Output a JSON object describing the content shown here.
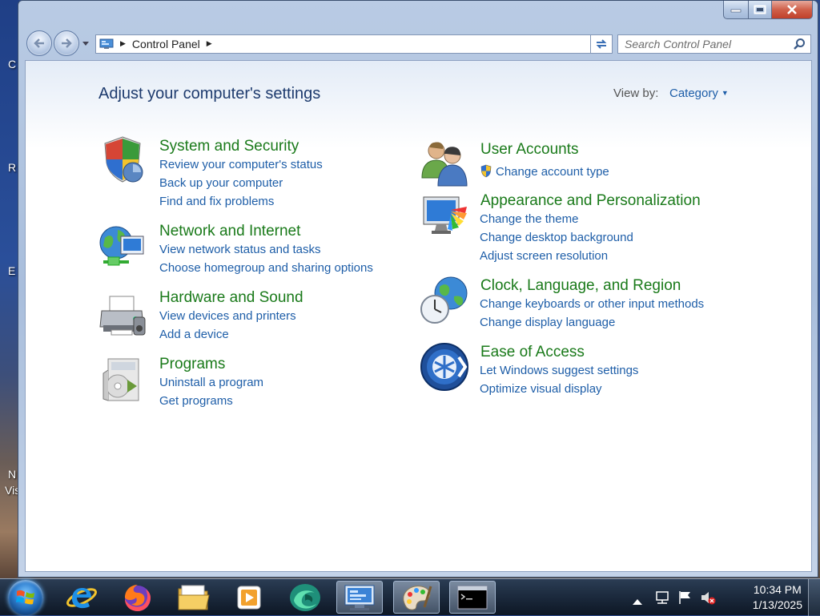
{
  "window": {
    "title_buttons": {
      "minimize": "minimize-icon",
      "maximize": "maximize-icon",
      "close": "close-icon"
    }
  },
  "navbar": {
    "breadcrumb": [
      "Control Panel"
    ],
    "search": {
      "placeholder": "Search Control Panel",
      "value": ""
    }
  },
  "page": {
    "title": "Adjust your computer's settings",
    "view_by": {
      "label": "View by:",
      "value": "Category"
    }
  },
  "categories_left": [
    {
      "title": "System and Security",
      "icon": "shield-icon",
      "links": [
        "Review your computer's status",
        "Back up your computer",
        "Find and fix problems"
      ]
    },
    {
      "title": "Network and Internet",
      "icon": "network-globe-icon",
      "links": [
        "View network status and tasks",
        "Choose homegroup and sharing options"
      ]
    },
    {
      "title": "Hardware and Sound",
      "icon": "printer-icon",
      "links": [
        "View devices and printers",
        "Add a device"
      ]
    },
    {
      "title": "Programs",
      "icon": "programs-icon",
      "links": [
        "Uninstall a program",
        "Get programs"
      ]
    }
  ],
  "categories_right": [
    {
      "title": "User Accounts",
      "icon": "users-icon",
      "links": [
        "Change account type"
      ]
    },
    {
      "title": "Appearance and Personalization",
      "icon": "monitor-colors-icon",
      "links": [
        "Change the theme",
        "Change desktop background",
        "Adjust screen resolution"
      ]
    },
    {
      "title": "Clock, Language, and Region",
      "icon": "clock-globe-icon",
      "links": [
        "Change keyboards or other input methods",
        "Change display language"
      ]
    },
    {
      "title": "Ease of Access",
      "icon": "ease-of-access-icon",
      "links": [
        "Let Windows suggest settings",
        "Optimize visual display"
      ]
    }
  ],
  "taskbar": {
    "apps": [
      "internet-explorer-icon",
      "firefox-icon",
      "file-explorer-icon",
      "media-player-icon",
      "browser-icon",
      "control-panel-icon",
      "paint-icon",
      "command-prompt-icon"
    ],
    "clock": {
      "time": "10:34 PM",
      "date": "1/13/2025"
    }
  },
  "desktop": {
    "edge_letters": [
      "C",
      "R",
      "E",
      "N",
      "Vis"
    ]
  }
}
